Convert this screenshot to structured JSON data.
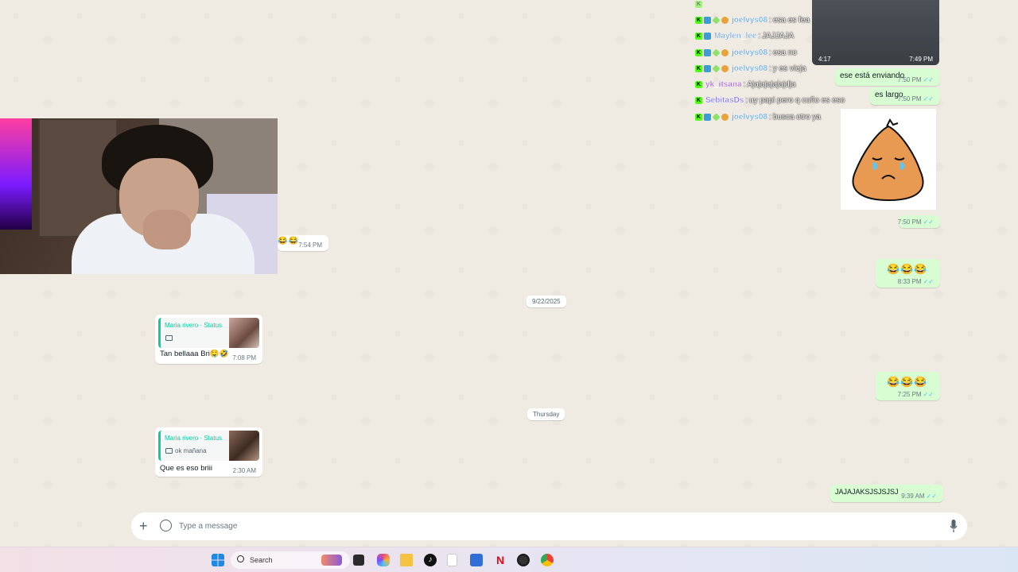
{
  "stream_chat": [
    {
      "user": "joelvys08",
      "message": "esa es fea",
      "color": "#5ca3e0"
    },
    {
      "user": "Maylen_lee",
      "message": "JAJJAJA",
      "color": "#6fa8dc"
    },
    {
      "user": "joelvys08",
      "message": "esa no",
      "color": "#5ca3e0"
    },
    {
      "user": "joelvys08",
      "message": "y es vieja",
      "color": "#5ca3e0"
    },
    {
      "user": "yk_itsana",
      "message": "Ajajajajajajdja",
      "color": "#a25bd6"
    },
    {
      "user": "SebitasDs",
      "message": "uy papi pero q coño es eso",
      "color": "#7e6ef0"
    },
    {
      "user": "joelvys08",
      "message": "busca otro ya",
      "color": "#5ca3e0"
    }
  ],
  "video": {
    "duration": "4:17",
    "time": "7:49 PM"
  },
  "messages": {
    "m1": {
      "text": "ese está enviando",
      "time": "7:50 PM"
    },
    "m2": {
      "text": "es largo",
      "time": "7:50 PM"
    },
    "sticker_time": "7:50 PM",
    "left_partial": {
      "text": "😂😂",
      "time": "7:54 PM"
    },
    "m3": {
      "text": "😂😂😂",
      "time": "8:33 PM"
    },
    "m4": {
      "text": "😂😂😂",
      "time": "7:25 PM"
    },
    "m5": {
      "text": "JAJAJAKSJSJSJSJ",
      "time": "9:39 AM"
    }
  },
  "dates": {
    "d1": "9/22/2025",
    "d2": "Thursday"
  },
  "status_replies": {
    "r1": {
      "quote_title": "Maria rivero · Status",
      "quote_sub": "",
      "text": "Tan bellaaa Bri🤤🤣",
      "time": "7:08 PM"
    },
    "r2": {
      "quote_title": "Maria rivero · Status",
      "quote_sub": "ok mañana",
      "text": "Que es eso briii",
      "time": "2:30 AM"
    }
  },
  "composer": {
    "placeholder": "Type a message"
  },
  "taskbar": {
    "search_label": "Search"
  },
  "colors": {
    "outgoing": "#d9fdd3",
    "incoming": "#ffffff",
    "accent": "#06cf9c",
    "tick": "#53bdeb"
  }
}
